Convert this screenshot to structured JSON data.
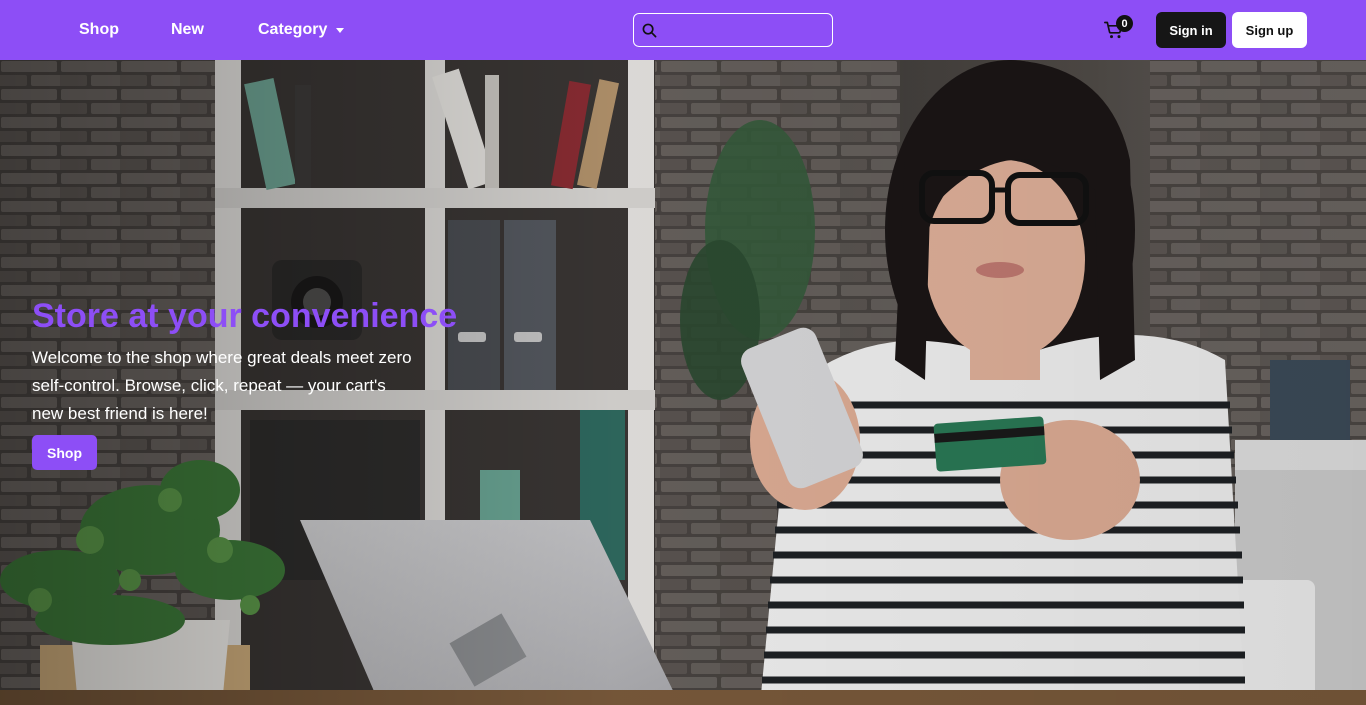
{
  "navbar": {
    "links": {
      "shop": "Shop",
      "new": "New",
      "category": "Category"
    },
    "search": {
      "value": "",
      "placeholder": ""
    },
    "cart_count": "0",
    "signin_label": "Sign in",
    "signup_label": "Sign up",
    "icons": {
      "search": "search-icon",
      "cart": "cart-icon",
      "category_caret": "chevron-down-icon"
    }
  },
  "hero": {
    "title": "Store at your convenience",
    "text": "Welcome to the shop where great deals meet zero self-control. Browse, click, repeat — your cart's new best friend is here!",
    "button_label": "Shop"
  },
  "colors": {
    "accent": "#8d4ef6",
    "dark_button": "#161616",
    "white": "#ffffff"
  }
}
